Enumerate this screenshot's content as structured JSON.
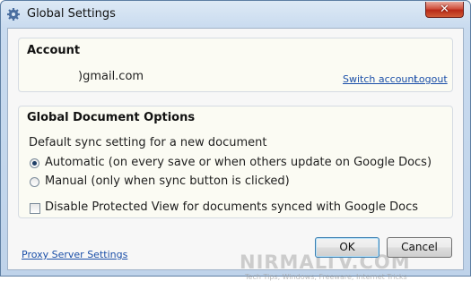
{
  "window": {
    "title": "Global Settings",
    "close_glyph": "✕"
  },
  "account": {
    "heading": "Account",
    "email": ")gmail.com",
    "switch_link": "Switch account",
    "logout_link": "Logout"
  },
  "options": {
    "heading": "Global Document Options",
    "sync_label": "Default sync setting for a new document",
    "radio_automatic": "Automatic (on every save or when others update on Google Docs)",
    "radio_manual": "Manual (only when sync button is clicked)",
    "selected": "automatic",
    "checkbox_protected_view": "Disable Protected View for documents synced with Google Docs",
    "checkbox_checked": false
  },
  "footer": {
    "proxy_link": "Proxy Server Settings",
    "ok_label": "OK",
    "cancel_label": "Cancel"
  },
  "watermark": {
    "text": "NIRMALTV.COM",
    "sub": "Tech Tips, Windows, Freeware, Internet Tricks"
  },
  "colors": {
    "link": "#1b4fa8",
    "close_button": "#c0392b",
    "titlebar": "#c9dbef"
  }
}
